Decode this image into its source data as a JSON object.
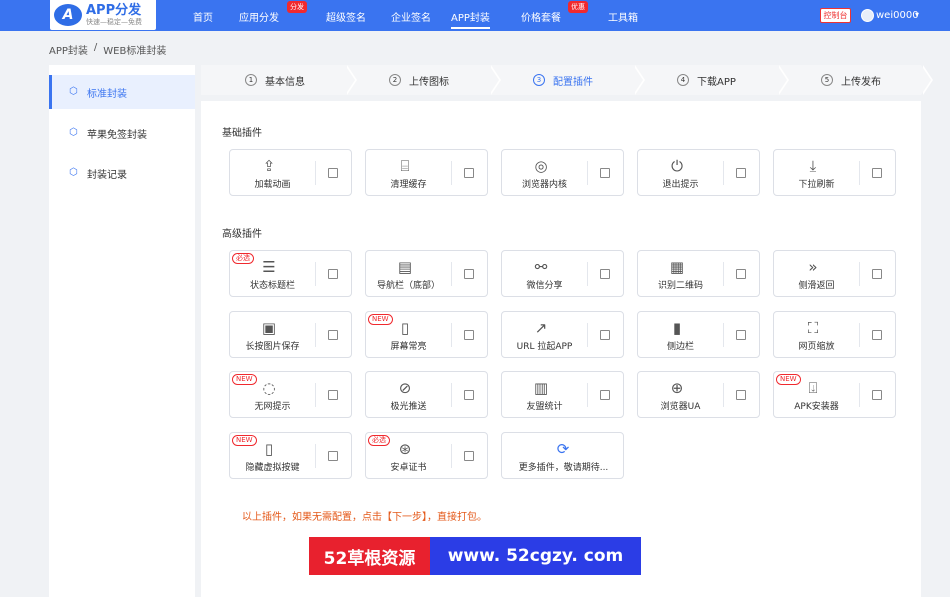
{
  "brand": {
    "title": "APP分发",
    "subtitle": "快速—稳定—免费",
    "mark": "A"
  },
  "nav": [
    {
      "label": "首页"
    },
    {
      "label": "应用分发",
      "badge": "分发"
    },
    {
      "label": "超级签名"
    },
    {
      "label": "企业签名"
    },
    {
      "label": "APP封装"
    },
    {
      "label": "价格套餐",
      "badge": "优惠"
    },
    {
      "label": "工具箱"
    }
  ],
  "header": {
    "console": "控制台",
    "username": "wei0000",
    "caret": "▾"
  },
  "breadcrumb": {
    "root": "APP封装",
    "sep": "/",
    "current": "WEB标准封装"
  },
  "sidebar": [
    {
      "label": "标准封装",
      "icon": "box-icon"
    },
    {
      "label": "苹果免签封装",
      "icon": "box-icon"
    },
    {
      "label": "封装记录",
      "icon": "box-icon"
    }
  ],
  "steps": [
    {
      "num": "1",
      "label": "基本信息"
    },
    {
      "num": "2",
      "label": "上传图标"
    },
    {
      "num": "3",
      "label": "配置插件"
    },
    {
      "num": "4",
      "label": "下载APP"
    },
    {
      "num": "5",
      "label": "上传发布"
    }
  ],
  "sections": {
    "basic": "基础插件",
    "advanced": "高级插件"
  },
  "basic_plugins": [
    {
      "label": "加载动画",
      "icon": "upload-icon",
      "glyph": "⇪"
    },
    {
      "label": "清理缓存",
      "icon": "broom-icon",
      "glyph": "⌸"
    },
    {
      "label": "浏览器内核",
      "icon": "planet-icon",
      "glyph": "◎"
    },
    {
      "label": "退出提示",
      "icon": "power-icon",
      "glyph": "⏻"
    },
    {
      "label": "下拉刷新",
      "icon": "pull-down-icon",
      "glyph": "⤓"
    }
  ],
  "advanced_plugins": [
    {
      "label": "状态标题栏",
      "icon": "menu-circle-icon",
      "glyph": "☰",
      "badge": "必选"
    },
    {
      "label": "导航栏（底部）",
      "icon": "document-icon",
      "glyph": "▤"
    },
    {
      "label": "微信分享",
      "icon": "share-icon",
      "glyph": "⚯"
    },
    {
      "label": "识别二维码",
      "icon": "qrcode-icon",
      "glyph": "▦"
    },
    {
      "label": "侧滑返回",
      "icon": "double-chevron-icon",
      "glyph": "»"
    },
    {
      "label": "长按图片保存",
      "icon": "save-icon",
      "glyph": "▣"
    },
    {
      "label": "屏幕常亮",
      "icon": "phone-bright-icon",
      "glyph": "▯",
      "badge": "NEW"
    },
    {
      "label": "URL 拉起APP",
      "icon": "external-link-icon",
      "glyph": "↗"
    },
    {
      "label": "侧边栏",
      "icon": "sidebar-phone-icon",
      "glyph": "▮"
    },
    {
      "label": "网页缩放",
      "icon": "zoom-icon",
      "glyph": "⛶"
    },
    {
      "label": "无网提示",
      "icon": "wifi-off-icon",
      "glyph": "◌",
      "badge": "NEW"
    },
    {
      "label": "极光推送",
      "icon": "push-icon",
      "glyph": "⊘"
    },
    {
      "label": "友盟统计",
      "icon": "bar-chart-icon",
      "glyph": "▥"
    },
    {
      "label": "浏览器UA",
      "icon": "globe-icon",
      "glyph": "⊕"
    },
    {
      "label": "APK安装器",
      "icon": "apk-install-icon",
      "glyph": "⍗",
      "badge": "NEW"
    },
    {
      "label": "隐藏虚拟按键",
      "icon": "phone-icon",
      "glyph": "▯",
      "badge": "NEW"
    },
    {
      "label": "安卓证书",
      "icon": "certificate-icon",
      "glyph": "⊛",
      "badge": "必选"
    }
  ],
  "more_plugins": {
    "label": "更多插件，敬请期待...",
    "glyph": "⟳"
  },
  "hint": "以上插件，如果无需配置，点击【下一步】，直接打包。",
  "watermark": {
    "left": "52草根资源",
    "right": "www. 52cgzy. com"
  }
}
